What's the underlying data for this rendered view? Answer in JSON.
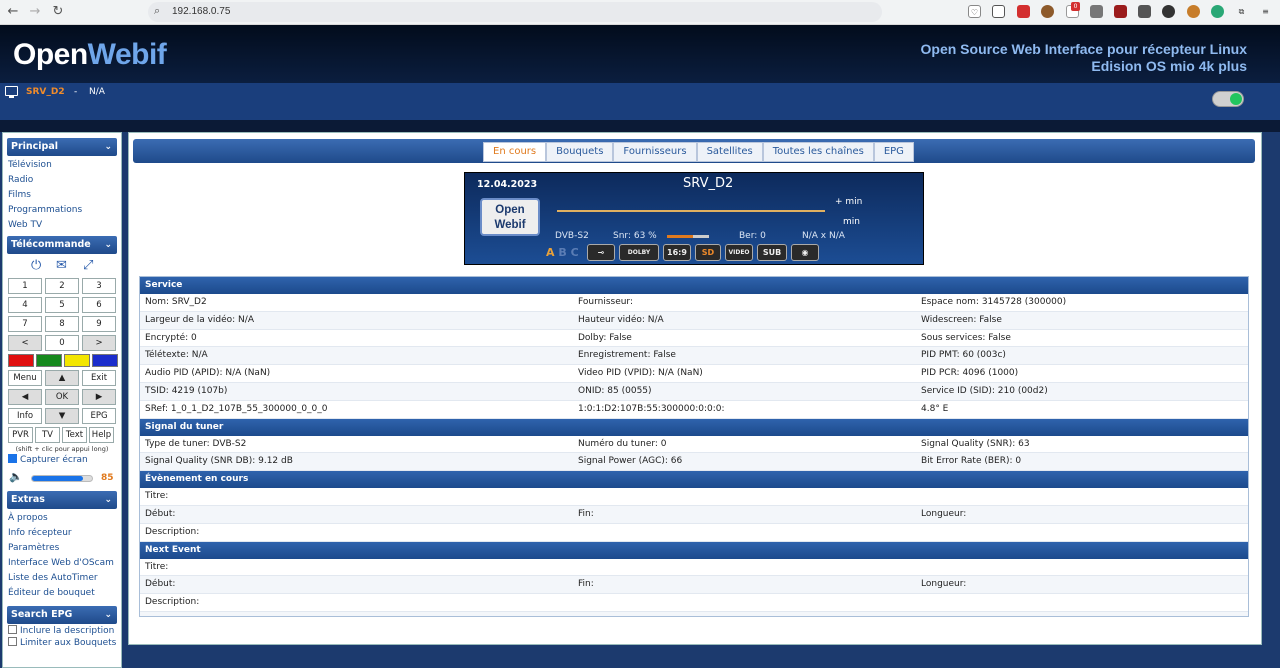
{
  "browser": {
    "url": "192.168.0.75",
    "ext_badge": "0"
  },
  "header": {
    "logo_open": "Open",
    "logo_webif": "Webif",
    "tagline_1": "Open Source Web Interface pour récepteur Linux",
    "tagline_2": "Edision OS mio 4k plus"
  },
  "status": {
    "channel": "SRV_D2",
    "separator": "-",
    "event": "N/A"
  },
  "sidebar": {
    "principal": {
      "title": "Principal",
      "items": [
        "Télévision",
        "Radio",
        "Films",
        "Programmations",
        "Web TV"
      ]
    },
    "remote": {
      "title": "Télécommande",
      "digits": [
        "1",
        "2",
        "3",
        "4",
        "5",
        "6",
        "7",
        "8",
        "9",
        "<",
        "0",
        ">"
      ],
      "colors": [
        "#e01010",
        "#16891d",
        "#f3e600",
        "#1b2dcc"
      ],
      "nav": [
        "Menu",
        "▲",
        "Exit",
        "◀",
        "OK",
        "▶",
        "Info",
        "▼",
        "EPG"
      ],
      "small": [
        "PVR",
        "TV",
        "Text",
        "Help"
      ],
      "hint": "(shift + clic pour appui long)",
      "capture_label": "Capturer écran",
      "volume": 85
    },
    "extras": {
      "title": "Extras",
      "items": [
        "À propos",
        "Info récepteur",
        "Paramètres",
        "Interface Web d'OScam",
        "Liste des AutoTimer",
        "Éditeur de bouquet"
      ]
    },
    "search_epg": {
      "title": "Search EPG",
      "opt1": "Inclure la description",
      "opt2": "Limiter aux Bouquets"
    }
  },
  "tabs": [
    "En cours",
    "Bouquets",
    "Fournisseurs",
    "Satellites",
    "Toutes les chaînes",
    "EPG"
  ],
  "infobar": {
    "date": "12.04.2023",
    "channel": "SRV_D2",
    "logo_1": "Open",
    "logo_2": "Webif",
    "plus_min": "+ min",
    "min": "min",
    "tuner": "DVB-S2",
    "snr": "Snr: 63 %",
    "snr_value": 63,
    "ber": "Ber: 0",
    "resolution": "N/A x N/A",
    "abc_a": "A",
    "abc_bc": "B C",
    "badges": [
      "⊸",
      "DOLBY",
      "16:9",
      "SD",
      "VIDEO",
      "SUB",
      "◉"
    ]
  },
  "service": {
    "title": "Service",
    "rows": [
      [
        "Nom: SRV_D2",
        "Fournisseur:",
        "Espace nom: 3145728 (300000)"
      ],
      [
        "Largeur de la vidéo: N/A",
        "Hauteur vidéo: N/A",
        "Widescreen: False"
      ],
      [
        "Encrypté: 0",
        "Dolby: False",
        "Sous services: False"
      ],
      [
        "Télétexte: N/A",
        "Enregistrement: False",
        "PID PMT: 60 (003c)"
      ],
      [
        "Audio PID (APID): N/A (NaN)",
        "Video PID (VPID): N/A (NaN)",
        "PID PCR: 4096 (1000)"
      ],
      [
        "TSID: 4219 (107b)",
        "ONID: 85 (0055)",
        "Service ID (SID): 210 (00d2)"
      ],
      [
        "SRef: 1_0_1_D2_107B_55_300000_0_0_0",
        "1:0:1:D2:107B:55:300000:0:0:0:",
        "4.8° E"
      ]
    ]
  },
  "tuner": {
    "title": "Signal du tuner",
    "rows": [
      [
        "Type de tuner: DVB-S2",
        "Numéro du tuner: 0",
        "Signal Quality (SNR): 63"
      ],
      [
        "Signal Quality (SNR DB): 9.12 dB",
        "Signal Power (AGC): 66",
        "Bit Error Rate (BER): 0"
      ]
    ]
  },
  "current_event": {
    "title": "Évènement en cours",
    "title_label": "Titre:",
    "start_label": "Début:",
    "end_label": "Fin:",
    "length_label": "Longueur:",
    "desc_label": "Description:"
  },
  "next_event": {
    "title": "Next Event",
    "title_label": "Titre:",
    "start_label": "Début:",
    "end_label": "Fin:",
    "length_label": "Longueur:",
    "desc_label": "Description:"
  }
}
